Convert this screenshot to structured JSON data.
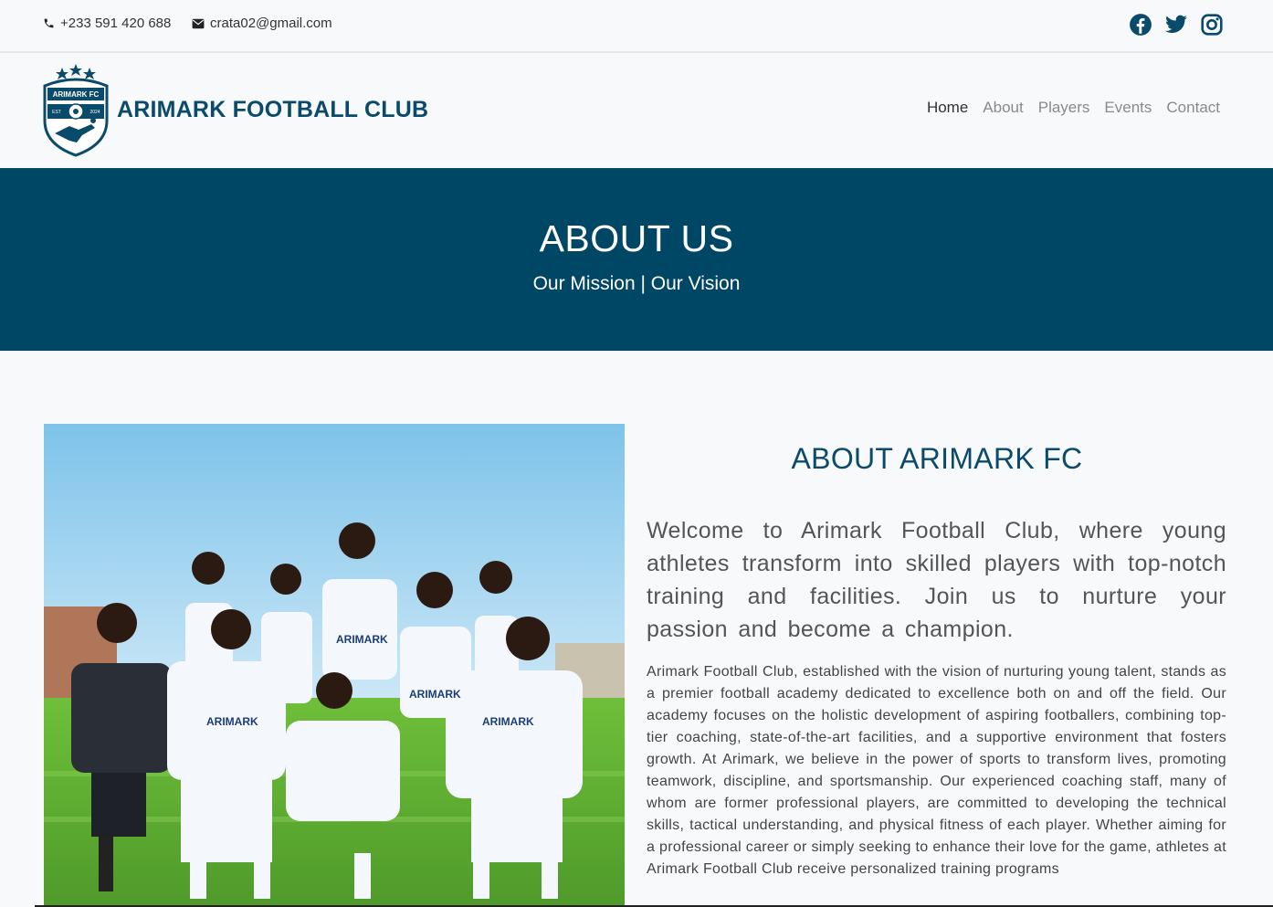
{
  "topbar": {
    "phone": "+233 591 420 688",
    "email": "crata02@gmail.com",
    "social_icons": [
      "facebook-icon",
      "twitter-icon",
      "instagram-icon"
    ]
  },
  "header": {
    "club_name": "ARIMARK FOOTBALL CLUB",
    "logo": {
      "text_top": "ARIMARK FC",
      "est": "EST",
      "year": "2024"
    }
  },
  "nav": {
    "items": [
      "Home",
      "About",
      "Players",
      "Events",
      "Contact"
    ],
    "active": "Home"
  },
  "hero": {
    "title": "ABOUT US",
    "subtitle": "Our Mission | Our Vision"
  },
  "about": {
    "title": "ABOUT ARIMARK FC",
    "lead": "Welcome to Arimark Football Club, where young athletes transform into skilled players with top-notch training and facilities. Join us to nurture your passion and become a champion.",
    "body": "Arimark Football Club, established with the vision of nurturing young talent, stands as a premier football academy dedicated to excellence both on and off the field. Our academy focuses on the holistic development of aspiring footballers, combining top-tier coaching, state-of-the-art facilities, and a supportive environment that fosters growth. At Arimark, we believe in the power of sports to transform lives, promoting teamwork, discipline, and sportsmanship. Our experienced coaching staff, many of whom are former professional players, are committed to developing the technical skills, tactical understanding, and physical fitness of each player. Whether aiming for a professional career or simply seeking to enhance their love for the game, athletes at Arimark Football Club receive personalized training programs",
    "photo_jersey_text": [
      "ARIMARK",
      "ARIMARK",
      "ARIMARK",
      "ARIMARK"
    ]
  },
  "colors": {
    "primary": "#004766",
    "heading": "#0a4a6a",
    "background": "#f7f9fb"
  }
}
